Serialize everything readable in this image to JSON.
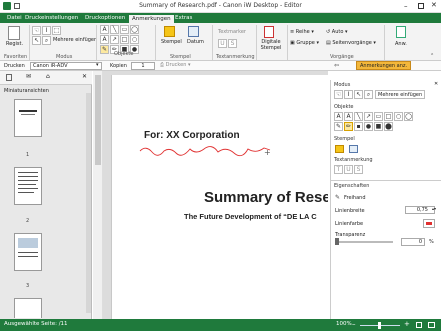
{
  "window": {
    "title": "Summary of Research.pdf - Canon iW Desktop - Editor"
  },
  "menu_tabs": [
    "Datei",
    "Druckeinstellungen",
    "Druckoptionen",
    "Anmerkungen",
    "Extras"
  ],
  "ribbon": {
    "groups": {
      "favoriten": "Favoriten",
      "modus": "Modus",
      "objekte": "Objekte",
      "stempel": "Stempel",
      "textanmerkung": "Textanmerkung",
      "vorgaenge": "Vorgänge"
    },
    "buttons": {
      "regist": "Regist.",
      "mehrere": "Mehrere einfügen",
      "stempel": "Stempel",
      "datum": "Datum",
      "textmarker": "Textmarker",
      "digitale_stempel": "Digitale Stempel",
      "reihe": "Reihe",
      "gruppe": "Gruppe",
      "auto": "Auto",
      "seitenvorgaenge": "Seitenvorgänge",
      "anw": "Anw."
    }
  },
  "toolbar": {
    "drucken_label": "Drucken",
    "printer": "Canon iR-ADV",
    "kopien_label": "Kopien",
    "kopien_value": "1",
    "drucken_btn": "Drucken",
    "anmerkungen_btn": "Anmerkungen anz."
  },
  "thumbnails": {
    "header": "Miniaturansichten",
    "pages": [
      "1",
      "2",
      "3"
    ]
  },
  "document": {
    "for_text": "For: XX Corporation",
    "title": "Summary of Rese",
    "subtitle": "The Future Development of “DE LA C"
  },
  "right_panel": {
    "modus": "Modus",
    "mehrere": "Mehrere einfügen",
    "objekte": "Objekte",
    "stempel": "Stempel",
    "textanmerkung": "Textanmerkung",
    "eigenschaften": "Eigenschaften",
    "freihand": "Freihand",
    "linienbreite": "Linienbreite",
    "linienbreite_value": "0,75",
    "linienfarbe": "Linienfarbe",
    "transparenz": "Transparenz",
    "transparenz_value": "0",
    "percent": "%"
  },
  "status": {
    "left": "Ausgewählte Seite: /11",
    "zoom": "100%"
  },
  "colors": {
    "accent": "#1f7a3c",
    "annotation_red": "#e03030",
    "highlight_yellow": "#f5c518"
  }
}
